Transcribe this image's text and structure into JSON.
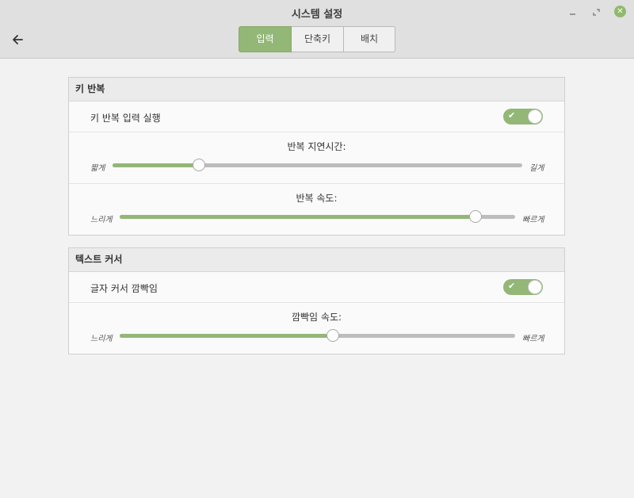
{
  "window": {
    "title": "시스템 설정",
    "controls": {
      "minimize": "minimize-icon",
      "maximize": "maximize-icon",
      "close": "close-icon"
    }
  },
  "header": {
    "back_icon": "arrow-left-icon",
    "tabs": [
      {
        "label": "입력",
        "active": true
      },
      {
        "label": "단축키",
        "active": false
      },
      {
        "label": "배치",
        "active": false
      }
    ]
  },
  "sections": {
    "key_repeat": {
      "title": "키 반복",
      "enable_label": "키 반복 입력 실행",
      "enable_on": true,
      "delay": {
        "title": "반복 지연시간:",
        "min_label": "짧게",
        "max_label": "길게",
        "value": 0.21
      },
      "speed": {
        "title": "반복 속도:",
        "min_label": "느리게",
        "max_label": "빠르게",
        "value": 0.9
      }
    },
    "text_cursor": {
      "title": "텍스트 커서",
      "blink_label": "글자 커서 깜빡임",
      "blink_on": true,
      "blink_speed": {
        "title": "깜빡임 속도:",
        "min_label": "느리게",
        "max_label": "빠르게",
        "value": 0.54
      }
    }
  },
  "colors": {
    "accent": "#93b776",
    "track": "#bdbdbd",
    "header_bg": "#e0e0e0",
    "page_bg": "#f2f2f2"
  }
}
